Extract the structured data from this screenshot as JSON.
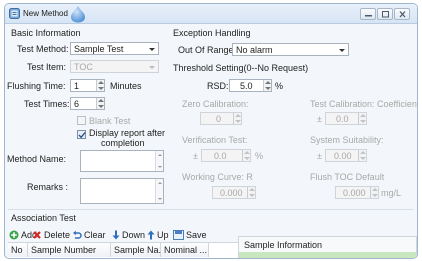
{
  "window": {
    "title": "New Method"
  },
  "basic": {
    "section_title": "Basic Information",
    "test_method_label": "Test Method:",
    "test_method_value": "Sample Test",
    "test_item_label": "Test Item:",
    "test_item_value": "TOC",
    "flushing_time_label": "Flushing Time:",
    "flushing_time_value": "1",
    "flushing_time_unit": "Minutes",
    "test_times_label": "Test Times:",
    "test_times_value": "6",
    "blank_test_label": "Blank Test",
    "blank_test_checked": false,
    "display_report_label_1": "Display report after",
    "display_report_label_2": "completion",
    "display_report_checked": true,
    "method_name_label": "Method Name:",
    "method_name_value": "",
    "remarks_label": "Remarks :",
    "remarks_value": ""
  },
  "exception": {
    "section_title": "Exception Handling",
    "out_of_range_label": "Out Of Range:",
    "out_of_range_value": "No alarm"
  },
  "threshold": {
    "section_title": "Threshold Setting(0--No Request)",
    "rsd_label": "RSD:",
    "rsd_value": "5.0",
    "rsd_unit": "%",
    "zero_cal_label": "Zero Calibration:",
    "zero_cal_value": "0",
    "test_cal_coeff_label": "Test Calibration: Coefficient",
    "test_cal_coeff_prefix": "±",
    "test_cal_coeff_value": "0.0",
    "verification_label": "Verification Test:",
    "verification_prefix": "±",
    "verification_value": "0.0",
    "verification_unit": "%",
    "system_suit_label": "System Suitability:",
    "system_suit_prefix": "±",
    "system_suit_value": "0.00",
    "working_curve_label": "Working Curve: R",
    "working_curve_value": "0.000",
    "flush_toc_label": "Flush TOC Default",
    "flush_toc_value": "0.000",
    "flush_toc_unit": "mg/L"
  },
  "association": {
    "section_title": "Association Test",
    "toolbar": {
      "add": "Add",
      "delete": "Delete",
      "clear": "Clear",
      "down": "Down",
      "up": "Up",
      "save": "Save"
    },
    "columns": [
      "No",
      "Sample Number",
      "Sample Na...",
      "Nominal ..."
    ],
    "sample_info_title": "Sample Information"
  },
  "colors": {
    "title_gradient_top": "#e9f1fb",
    "sample_info_bg": "#c9e7bf",
    "logo_blue": "#4c8fd6"
  }
}
